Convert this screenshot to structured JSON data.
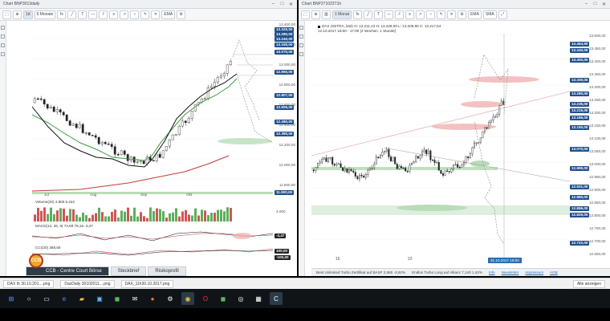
{
  "left_window": {
    "title": "Chart BNP3013daily",
    "toolbar": [
      "1d",
      "6 Monate",
      "fx",
      "EMA"
    ],
    "series_label": "DAX (XETRA, last)",
    "legend": [
      {
        "name": "EMA(20)",
        "color": "#3d9a3d"
      },
      {
        "name": "EMA(200)",
        "color": "#c23a3a"
      },
      {
        "name": "SMA(20)",
        "color": "#111111"
      }
    ],
    "date_range": "23.09.2017 - 27.10.2017 (4 Monate, 1 Tag)",
    "x_ticks": [
      "Jul",
      "Aug",
      "Sep",
      "Okt"
    ],
    "y_ticks": [
      "13.400,00",
      "13.200,00",
      "13.000,00",
      "12.800,00",
      "12.600,00",
      "12.400,00",
      "12.200,00",
      "12.000,00",
      "11.800,00"
    ],
    "price_pills": [
      {
        "text": "13.320,00",
        "color": "#1f4f8c"
      },
      {
        "text": "13.280,00",
        "color": "#1f4f8c"
      },
      {
        "text": "13.240,00",
        "color": "#1f4f8c"
      },
      {
        "text": "13.150,00",
        "color": "#1f4f8c"
      },
      {
        "text": "13.070,00",
        "color": "#1f4f8c"
      },
      {
        "text": "12.950,00",
        "color": "#1f4f8c"
      },
      {
        "text": "12.807,00",
        "color": "#1f4f8c"
      },
      {
        "text": "12.605,00",
        "color": "#1f4f8c"
      },
      {
        "text": "12.480,00",
        "color": "#1f4f8c"
      },
      {
        "text": "12.380,00",
        "color": "#1f4f8c"
      },
      {
        "text": "11.900,00",
        "color": "#1f4f8c"
      }
    ],
    "volume_label": "Volume(20) 4.800 5.242",
    "volume_axis": "4.000",
    "macd_label": "MACD(12, 26, 9) 74,69 78,16 -3,47",
    "macd_value": "-3,47",
    "cci_label": "CCI(20) 368,56",
    "cci_values": [
      "100,00",
      "-100,00"
    ],
    "tabs": [
      "CCB - Centre Court Börse",
      "Steckbrief",
      "Risikoprofil"
    ],
    "logo_text": "CCB"
  },
  "right_window": {
    "title": "Chart BNP271023T1h",
    "toolbar": [
      "1 Monat",
      "fx",
      "EMA",
      "SMA"
    ],
    "series_label": "DAX (XETRA, last)  O: 13.211,13  H: 13.229,00  L: 13.209,90  C: 13.217,54",
    "date_range": "12.10.2017 16:00 - 17:00  (2 Wochen, 1 Stunde)",
    "x_ticks": [
      "16",
      "23"
    ],
    "y_ticks": [
      "13.500,00",
      "13.450,00",
      "13.400,00",
      "13.350,00",
      "13.300,00",
      "13.250,00",
      "13.200,00",
      "13.150,00",
      "13.100,00",
      "13.050,00",
      "13.000,00",
      "12.950,00",
      "12.900,00",
      "12.850,00",
      "12.800,00",
      "12.750,00",
      "12.700,00",
      "12.650,00"
    ],
    "price_pills": [
      {
        "text": "13.464,90",
        "color": "#1f4f8c"
      },
      {
        "text": "13.440,00",
        "color": "#1f4f8c"
      },
      {
        "text": "13.400,00",
        "color": "#1f4f8c"
      },
      {
        "text": "13.330,00",
        "color": "#1f4f8c"
      },
      {
        "text": "13.280,00",
        "color": "#1f4f8c"
      },
      {
        "text": "13.235,00",
        "color": "#1f4f8c"
      },
      {
        "text": "13.215,00",
        "color": "#1f4f8c"
      },
      {
        "text": "13.186,00",
        "color": "#1f4f8c"
      },
      {
        "text": "13.150,00",
        "color": "#1f4f8c"
      },
      {
        "text": "13.070,00",
        "color": "#1f4f8c"
      },
      {
        "text": "12.999,00",
        "color": "#1f4f8c"
      },
      {
        "text": "12.931,00",
        "color": "#1f4f8c"
      },
      {
        "text": "12.880,00",
        "color": "#1f4f8c"
      },
      {
        "text": "12.856,00",
        "color": "#1f4f8c"
      },
      {
        "text": "12.829,00",
        "color": "#1f4f8c"
      },
      {
        "text": "12.722,00",
        "color": "#1f4f8c"
      }
    ],
    "cursor_time": "31.10.2017 16:00",
    "status_items": [
      "Best Unlimited Turbo Zertifikat auf BASF 2,560 -3,92%",
      "Endlos Turbo Long auf Allianz 7,140 1,42%",
      "Info",
      "Newsletter",
      "Impressum",
      "AGB"
    ]
  },
  "downloads": [
    "DAX Ih 30.10.201....png",
    "DaxDaily 30102011....png",
    "DAX_11h30.10.2017.png"
  ],
  "downloads_all": "Alle anzeigen"
}
